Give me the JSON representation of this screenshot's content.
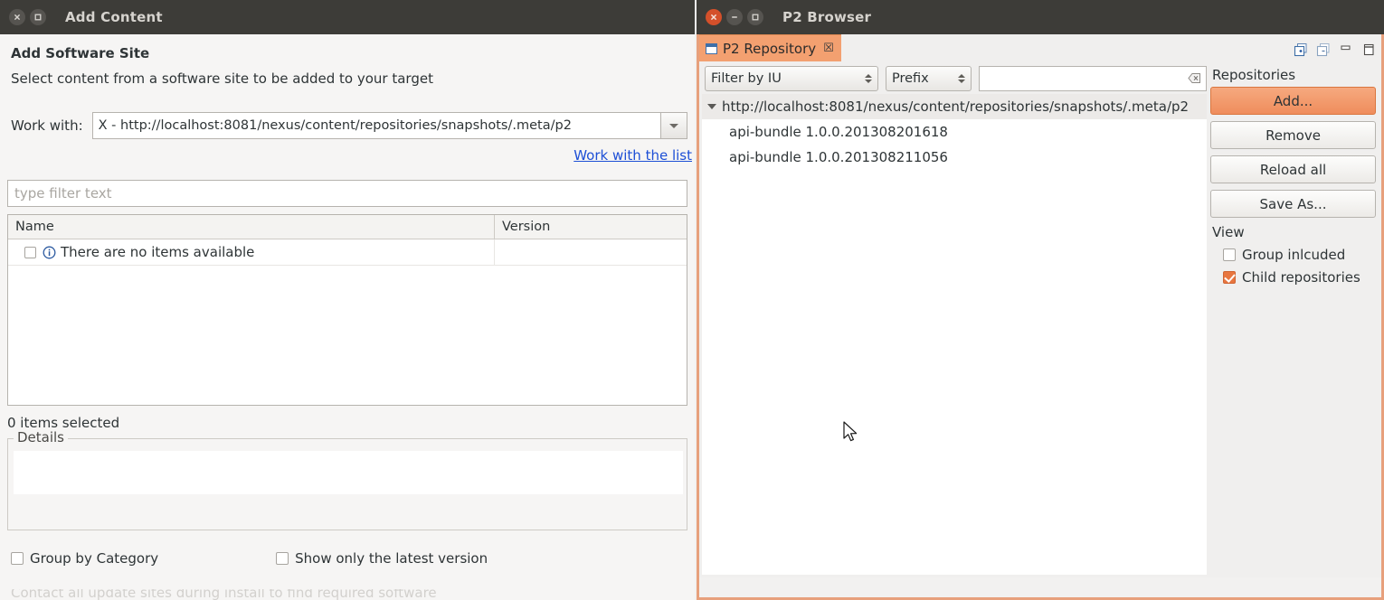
{
  "add_content_window": {
    "title": "Add Content",
    "window_buttons": [
      {
        "name": "close",
        "glyph": "×"
      },
      {
        "name": "maximize",
        "glyph": "□"
      }
    ],
    "heading": "Add Software Site",
    "subtitle": "Select content from a software site to be added to your target",
    "work_with": {
      "label": "Work with:",
      "value": "X - http://localhost:8081/nexus/content/repositories/snapshots/.meta/p2",
      "dropdown_icon": "chevron-down-icon"
    },
    "link": "Work with the list",
    "filter": {
      "placeholder": "type filter text",
      "value": ""
    },
    "table": {
      "columns": [
        "Name",
        "Version"
      ],
      "rows": [
        {
          "name": "There are no items available",
          "version": "",
          "checked": false,
          "icon": "info-icon"
        }
      ]
    },
    "items_selected": "0 items selected",
    "details": {
      "legend": "Details",
      "content": ""
    },
    "options": [
      {
        "label": "Group by Category",
        "checked": false
      },
      {
        "label": "Show only the latest version",
        "checked": false
      }
    ]
  },
  "p2_browser_window": {
    "title": "P2 Browser",
    "window_buttons": [
      {
        "name": "close",
        "glyph": "×"
      },
      {
        "name": "minimize",
        "glyph": "−"
      },
      {
        "name": "maximize",
        "glyph": "□"
      }
    ],
    "tab": {
      "label": "P2 Repository",
      "close_glyph": "☒",
      "icon": "view-icon"
    },
    "tab_tools": [
      "expand-all-icon",
      "collapse-all-icon",
      "minimize-view-icon",
      "maximize-view-icon"
    ],
    "filters": {
      "filter_by": "Filter by IU",
      "match_mode": "Prefix",
      "search_value": "",
      "search_placeholder": "",
      "clear_icon": "clear-icon"
    },
    "tree": {
      "root": "http://localhost:8081/nexus/content/repositories/snapshots/.meta/p2",
      "children": [
        "api-bundle 1.0.0.201308201618",
        "api-bundle 1.0.0.201308211056"
      ]
    },
    "side_panel": {
      "repositories_label": "Repositories",
      "buttons": [
        {
          "label": "Add...",
          "primary": true
        },
        {
          "label": "Remove",
          "primary": false
        },
        {
          "label": "Reload all",
          "primary": false
        },
        {
          "label": "Save As...",
          "primary": false
        }
      ],
      "view_label": "View",
      "view_options": [
        {
          "label": "Group inlcuded",
          "checked": false
        },
        {
          "label": "Child repositories",
          "checked": true
        }
      ]
    }
  },
  "colors": {
    "titlebar": "#3d3c38",
    "accent_orange": "#e8763f",
    "tab_orange": "#f3a070",
    "link_blue": "#1d4fd6",
    "close_red": "#d4502a"
  }
}
